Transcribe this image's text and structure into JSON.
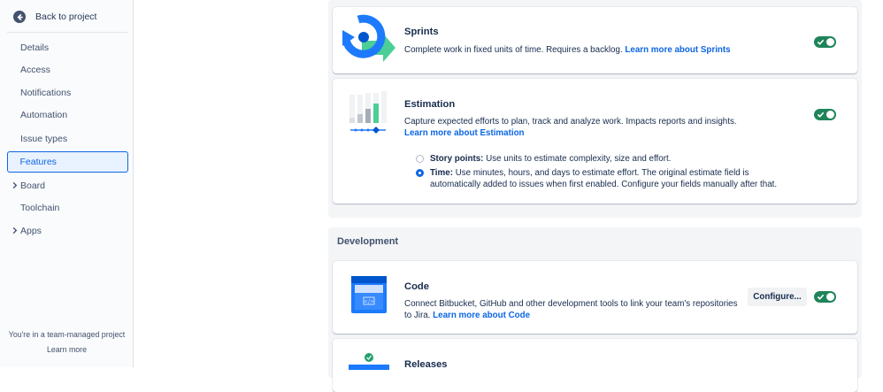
{
  "sidebar": {
    "back_label": "Back to project",
    "items": [
      {
        "label": "Details"
      },
      {
        "label": "Access"
      },
      {
        "label": "Notifications"
      },
      {
        "label": "Automation"
      },
      {
        "label": "Issue types"
      },
      {
        "label": "Features"
      },
      {
        "label": "Board"
      },
      {
        "label": "Toolchain"
      },
      {
        "label": "Apps"
      }
    ],
    "active_item": "Features",
    "team_note": "You're in a team-managed project",
    "learn_more": "Learn more"
  },
  "features": {
    "sprints": {
      "title": "Sprints",
      "description": "Complete work in fixed units of time. Requires a backlog.",
      "link": "Learn more about Sprints",
      "enabled": true
    },
    "estimation": {
      "title": "Estimation",
      "description": "Capture expected efforts to plan, track and analyze work. Impacts reports and insights.",
      "link": "Learn more about Estimation",
      "enabled": true,
      "options": [
        {
          "label": "Story points:",
          "text": "Use units to estimate complexity, size and effort.",
          "selected": false
        },
        {
          "label": "Time:",
          "text": "Use minutes, hours, and days to estimate effort. The original estimate field is automatically added to issues when first enabled. Configure your fields manually after that.",
          "selected": true
        }
      ]
    }
  },
  "development": {
    "heading": "Development",
    "code": {
      "title": "Code",
      "description": "Connect Bitbucket, GitHub and other development tools to link your team's repositories to Jira.",
      "link": "Learn more about Code",
      "configure_label": "Configure...",
      "enabled": true
    },
    "releases": {
      "title": "Releases"
    }
  },
  "colors": {
    "accent": "#0c66e4",
    "toggle_on": "#1f845a",
    "sprint_icon_blue": "#1d7afc",
    "sprint_icon_green": "#4bce97"
  },
  "icons": {
    "back": "arrow-left-circle-icon",
    "sprints": "sprints-illustration",
    "estimation": "estimation-illustration",
    "code": "code-illustration",
    "releases": "releases-illustration",
    "toggle_check": "check-icon",
    "chevron": "chevron-right-icon"
  }
}
